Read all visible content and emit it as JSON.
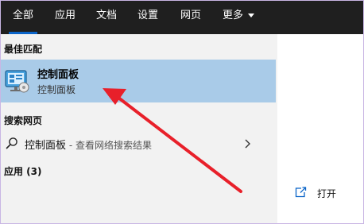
{
  "nav": {
    "tabs": [
      {
        "label": "全部"
      },
      {
        "label": "应用"
      },
      {
        "label": "文档"
      },
      {
        "label": "设置"
      },
      {
        "label": "网页"
      },
      {
        "label": "更多"
      }
    ],
    "active_tab": "全部"
  },
  "sections": {
    "best_match": "最佳匹配",
    "web": "搜索网页",
    "apps": "应用 (3)"
  },
  "best_match_item": {
    "title": "控制面板",
    "subtitle": "控制面板",
    "icon": "control-panel-icon"
  },
  "web_result": {
    "query": "控制面板",
    "separator": " - ",
    "hint": "查看网络搜索结果",
    "icon": "search-icon"
  },
  "actions": {
    "open_label": "打开",
    "open_icon": "open-window-icon"
  },
  "colors": {
    "nav_bg": "#1f1f1f",
    "highlight": "#a9cbe8",
    "accent": "#0a64c8",
    "arrow": "#e8202a"
  }
}
